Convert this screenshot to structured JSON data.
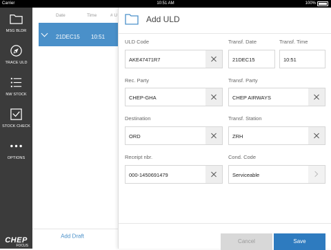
{
  "status": {
    "carrier": "Carrier",
    "time": "10:51 AM",
    "battery": "100%"
  },
  "sidebar": {
    "items": [
      {
        "label": "MSG BLDR",
        "icon": "folder-icon"
      },
      {
        "label": "TRACE ULD",
        "icon": "compass-icon"
      },
      {
        "label": "NW STOCK",
        "icon": "list-icon"
      },
      {
        "label": "STOCK CHECK",
        "icon": "check-box-icon"
      },
      {
        "label": "OPTIONS",
        "icon": "more-dots-icon"
      }
    ],
    "logo": {
      "main": "CHEP",
      "sub": "FOCUS"
    }
  },
  "list": {
    "headers": {
      "date": "Date",
      "time": "Time",
      "num": "# U"
    },
    "rows": [
      {
        "date": "21DEC15",
        "time": "10:51"
      }
    ],
    "add_draft": "Add Draft"
  },
  "detail": {
    "title": "Add ULD",
    "fields": {
      "uld_code": {
        "label": "ULD Code",
        "value": "AKE47471R7"
      },
      "transf_date": {
        "label": "Transf. Date",
        "value": "21DEC15"
      },
      "transf_time": {
        "label": "Transf. Time",
        "value": "10:51"
      },
      "rec_party": {
        "label": "Rec. Party",
        "value": "CHEP-GHA"
      },
      "transf_party": {
        "label": "Transf. Party",
        "value": "CHEP AIRWAYS"
      },
      "destination": {
        "label": "Destination",
        "value": "ORD"
      },
      "transf_station": {
        "label": "Transf. Station",
        "value": "ZRH"
      },
      "receipt_nbr": {
        "label": "Receipt nbr.",
        "value": "000-1450691479"
      },
      "cond_code": {
        "label": "Cond. Code",
        "value": "Serviceable"
      }
    },
    "cancel_label": "Cancel",
    "save_label": "Save"
  }
}
